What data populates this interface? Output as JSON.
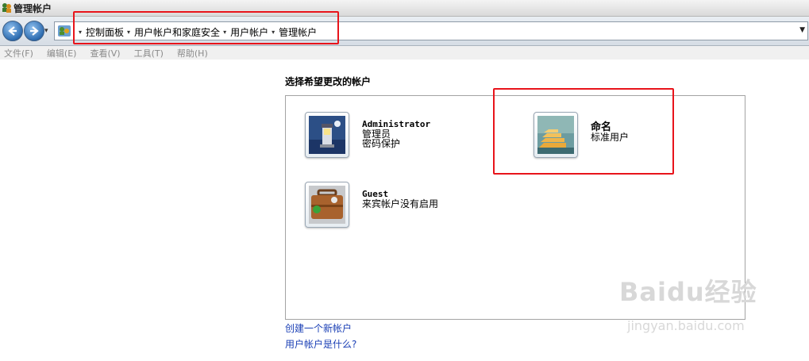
{
  "window": {
    "title": "管理帐户"
  },
  "address": {
    "crumbs": [
      "控制面板",
      "用户帐户和家庭安全",
      "用户帐户",
      "管理帐户"
    ]
  },
  "menu": {
    "items": [
      "文件(F)",
      "编辑(E)",
      "查看(V)",
      "工具(T)",
      "帮助(H)"
    ]
  },
  "main": {
    "title": "选择希望更改的帐户",
    "accounts": [
      {
        "name": "Administrator",
        "line1": "管理员",
        "line2": "密码保护",
        "picture": "lighthouse-picture"
      },
      {
        "name": "命名",
        "line1": "标准用户",
        "line2": "",
        "picture": "stairs-picture"
      },
      {
        "name": "Guest",
        "line1": "来宾帐户没有启用",
        "line2": "",
        "picture": "suitcase-picture"
      }
    ]
  },
  "links": {
    "create": "创建一个新帐户",
    "what_is": "用户帐户是什么?"
  },
  "watermark": {
    "brand": "Baidu经验",
    "url": "jingyan.baidu.com"
  },
  "colors": {
    "highlight": "#e8141b",
    "link": "#1a3fb5"
  }
}
